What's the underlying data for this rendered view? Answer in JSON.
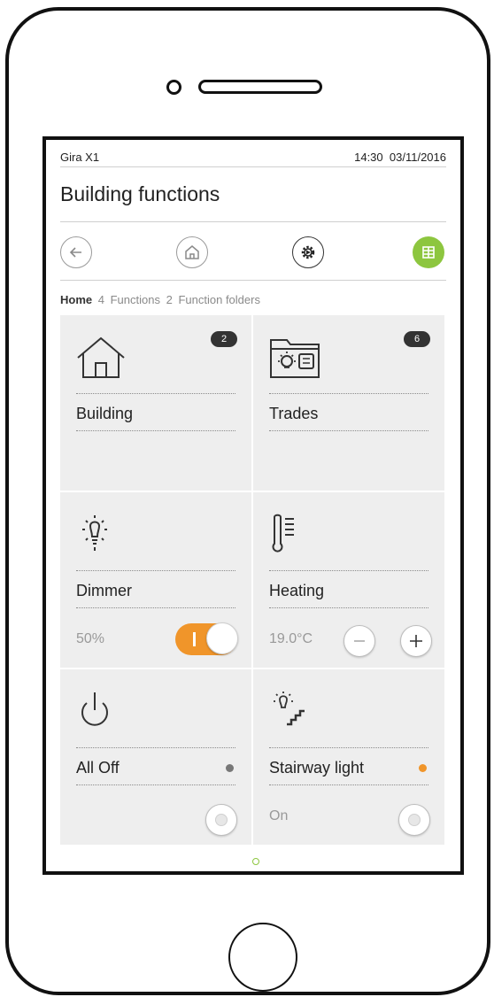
{
  "status": {
    "app_name": "Gira X1",
    "time": "14:30",
    "date": "03/11/2016"
  },
  "page": {
    "title": "Building functions"
  },
  "navbar": {
    "back_icon": "arrow-left-icon",
    "home_icon": "house-icon",
    "settings_icon": "gear-icon",
    "grid_icon": "grid-view-icon",
    "active_color": "#8dc63f"
  },
  "breadcrumb": {
    "items": [
      {
        "label": "Home",
        "count": "4"
      },
      {
        "label": "Functions",
        "count": "2"
      },
      {
        "label": "Function folders",
        "count": ""
      }
    ]
  },
  "tiles": {
    "building": {
      "label": "Building",
      "badge": "2",
      "icon": "house-icon"
    },
    "trades": {
      "label": "Trades",
      "badge": "6",
      "icon": "folder-bulb-icon"
    },
    "dimmer": {
      "label": "Dimmer",
      "value": "50%",
      "icon": "bulb-icon",
      "toggle_color": "#f0952a"
    },
    "heating": {
      "label": "Heating",
      "value": "19.0°C",
      "icon": "thermometer-icon"
    },
    "all_off": {
      "label": "All Off",
      "icon": "power-icon",
      "status_color": "#777777"
    },
    "stairway": {
      "label": "Stairway light",
      "value": "On",
      "icon": "stairway-light-icon",
      "status_color": "#f0952a"
    }
  }
}
